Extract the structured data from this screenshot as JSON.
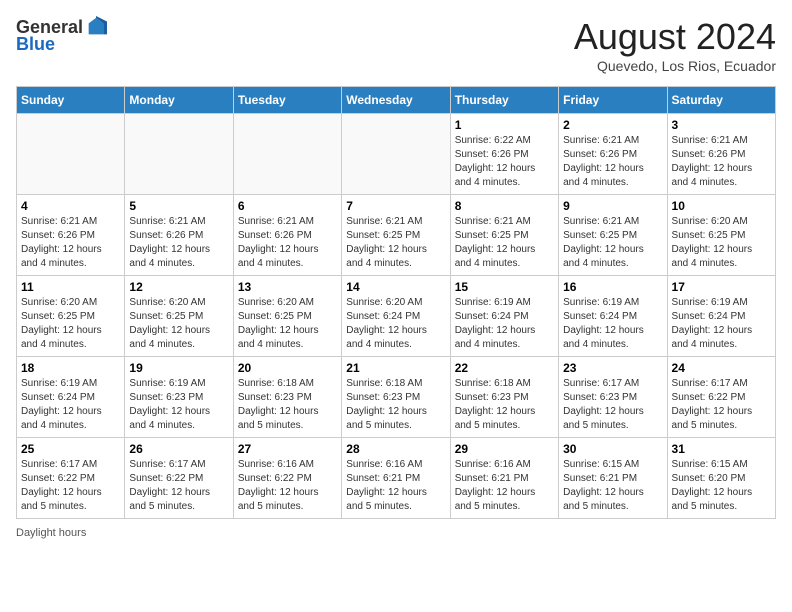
{
  "logo": {
    "general": "General",
    "blue": "Blue"
  },
  "title": "August 2024",
  "subtitle": "Quevedo, Los Rios, Ecuador",
  "days_header": [
    "Sunday",
    "Monday",
    "Tuesday",
    "Wednesday",
    "Thursday",
    "Friday",
    "Saturday"
  ],
  "weeks": [
    [
      {
        "day": "",
        "info": ""
      },
      {
        "day": "",
        "info": ""
      },
      {
        "day": "",
        "info": ""
      },
      {
        "day": "",
        "info": ""
      },
      {
        "day": "1",
        "info": "Sunrise: 6:22 AM\nSunset: 6:26 PM\nDaylight: 12 hours and 4 minutes."
      },
      {
        "day": "2",
        "info": "Sunrise: 6:21 AM\nSunset: 6:26 PM\nDaylight: 12 hours and 4 minutes."
      },
      {
        "day": "3",
        "info": "Sunrise: 6:21 AM\nSunset: 6:26 PM\nDaylight: 12 hours and 4 minutes."
      }
    ],
    [
      {
        "day": "4",
        "info": "Sunrise: 6:21 AM\nSunset: 6:26 PM\nDaylight: 12 hours and 4 minutes."
      },
      {
        "day": "5",
        "info": "Sunrise: 6:21 AM\nSunset: 6:26 PM\nDaylight: 12 hours and 4 minutes."
      },
      {
        "day": "6",
        "info": "Sunrise: 6:21 AM\nSunset: 6:26 PM\nDaylight: 12 hours and 4 minutes."
      },
      {
        "day": "7",
        "info": "Sunrise: 6:21 AM\nSunset: 6:25 PM\nDaylight: 12 hours and 4 minutes."
      },
      {
        "day": "8",
        "info": "Sunrise: 6:21 AM\nSunset: 6:25 PM\nDaylight: 12 hours and 4 minutes."
      },
      {
        "day": "9",
        "info": "Sunrise: 6:21 AM\nSunset: 6:25 PM\nDaylight: 12 hours and 4 minutes."
      },
      {
        "day": "10",
        "info": "Sunrise: 6:20 AM\nSunset: 6:25 PM\nDaylight: 12 hours and 4 minutes."
      }
    ],
    [
      {
        "day": "11",
        "info": "Sunrise: 6:20 AM\nSunset: 6:25 PM\nDaylight: 12 hours and 4 minutes."
      },
      {
        "day": "12",
        "info": "Sunrise: 6:20 AM\nSunset: 6:25 PM\nDaylight: 12 hours and 4 minutes."
      },
      {
        "day": "13",
        "info": "Sunrise: 6:20 AM\nSunset: 6:25 PM\nDaylight: 12 hours and 4 minutes."
      },
      {
        "day": "14",
        "info": "Sunrise: 6:20 AM\nSunset: 6:24 PM\nDaylight: 12 hours and 4 minutes."
      },
      {
        "day": "15",
        "info": "Sunrise: 6:19 AM\nSunset: 6:24 PM\nDaylight: 12 hours and 4 minutes."
      },
      {
        "day": "16",
        "info": "Sunrise: 6:19 AM\nSunset: 6:24 PM\nDaylight: 12 hours and 4 minutes."
      },
      {
        "day": "17",
        "info": "Sunrise: 6:19 AM\nSunset: 6:24 PM\nDaylight: 12 hours and 4 minutes."
      }
    ],
    [
      {
        "day": "18",
        "info": "Sunrise: 6:19 AM\nSunset: 6:24 PM\nDaylight: 12 hours and 4 minutes."
      },
      {
        "day": "19",
        "info": "Sunrise: 6:19 AM\nSunset: 6:23 PM\nDaylight: 12 hours and 4 minutes."
      },
      {
        "day": "20",
        "info": "Sunrise: 6:18 AM\nSunset: 6:23 PM\nDaylight: 12 hours and 5 minutes."
      },
      {
        "day": "21",
        "info": "Sunrise: 6:18 AM\nSunset: 6:23 PM\nDaylight: 12 hours and 5 minutes."
      },
      {
        "day": "22",
        "info": "Sunrise: 6:18 AM\nSunset: 6:23 PM\nDaylight: 12 hours and 5 minutes."
      },
      {
        "day": "23",
        "info": "Sunrise: 6:17 AM\nSunset: 6:23 PM\nDaylight: 12 hours and 5 minutes."
      },
      {
        "day": "24",
        "info": "Sunrise: 6:17 AM\nSunset: 6:22 PM\nDaylight: 12 hours and 5 minutes."
      }
    ],
    [
      {
        "day": "25",
        "info": "Sunrise: 6:17 AM\nSunset: 6:22 PM\nDaylight: 12 hours and 5 minutes."
      },
      {
        "day": "26",
        "info": "Sunrise: 6:17 AM\nSunset: 6:22 PM\nDaylight: 12 hours and 5 minutes."
      },
      {
        "day": "27",
        "info": "Sunrise: 6:16 AM\nSunset: 6:22 PM\nDaylight: 12 hours and 5 minutes."
      },
      {
        "day": "28",
        "info": "Sunrise: 6:16 AM\nSunset: 6:21 PM\nDaylight: 12 hours and 5 minutes."
      },
      {
        "day": "29",
        "info": "Sunrise: 6:16 AM\nSunset: 6:21 PM\nDaylight: 12 hours and 5 minutes."
      },
      {
        "day": "30",
        "info": "Sunrise: 6:15 AM\nSunset: 6:21 PM\nDaylight: 12 hours and 5 minutes."
      },
      {
        "day": "31",
        "info": "Sunrise: 6:15 AM\nSunset: 6:20 PM\nDaylight: 12 hours and 5 minutes."
      }
    ]
  ],
  "footer": "Daylight hours"
}
